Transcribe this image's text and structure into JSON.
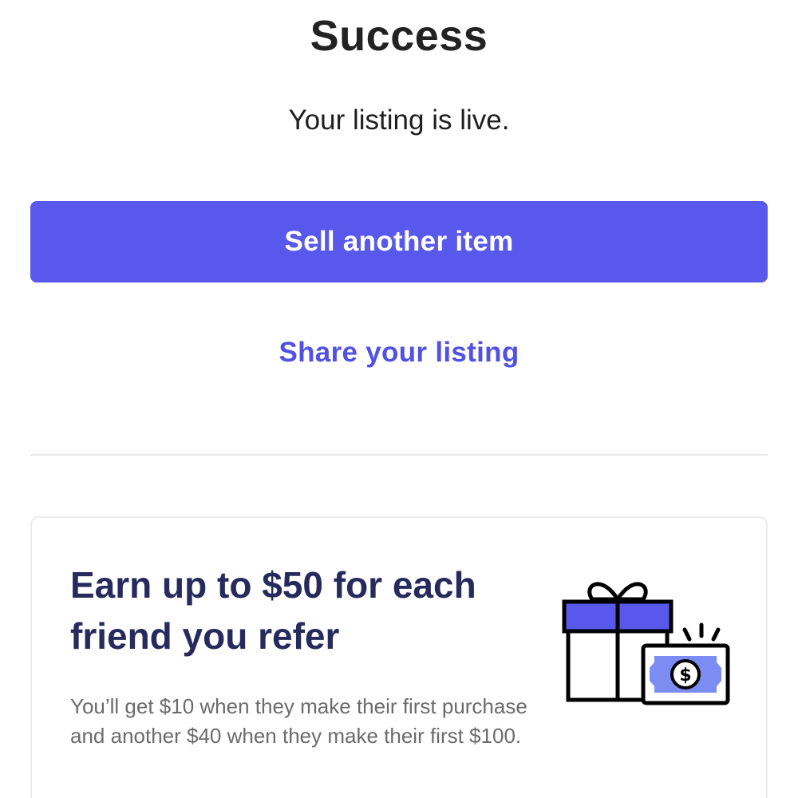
{
  "header": {
    "title": "Success",
    "subtitle": "Your listing is live."
  },
  "actions": {
    "primary_label": "Sell another item",
    "secondary_label": "Share your listing"
  },
  "promo": {
    "heading": "Earn up to $50 for each friend you refer",
    "body": "You’ll get $10 when they make their first purchase and another $40 when they make their first $100.",
    "icon": "gift-and-cash-icon",
    "bill_symbol": "$"
  },
  "colors": {
    "accent": "#5858ec",
    "link": "#5151e6",
    "heading": "#262a5c",
    "bill_fill": "#7b8cf2"
  }
}
